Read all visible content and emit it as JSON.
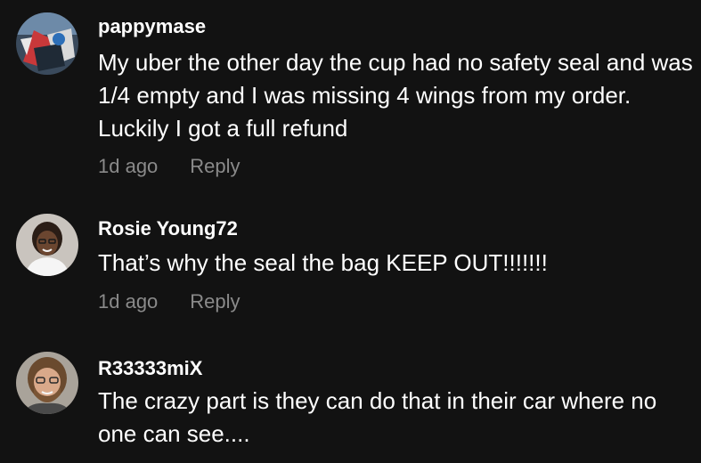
{
  "comments": [
    {
      "username": "pappymase",
      "text": "My uber the other day the cup had no safety seal and was 1/4 empty and I was missing 4 wings from my order. Luckily I got a full refund",
      "time": "1d ago",
      "reply_label": "Reply"
    },
    {
      "username": "Rosie Young72",
      "text": "That’s why the seal the bag KEEP OUT!!!!!!!",
      "time": "1d ago",
      "reply_label": "Reply"
    },
    {
      "username": "R33333miX",
      "text": "The crazy part is they can do that in their car where no one can see....",
      "time": "",
      "reply_label": ""
    }
  ],
  "colors": {
    "background": "#121212",
    "text": "#ffffff",
    "meta": "#8a8a8a"
  }
}
